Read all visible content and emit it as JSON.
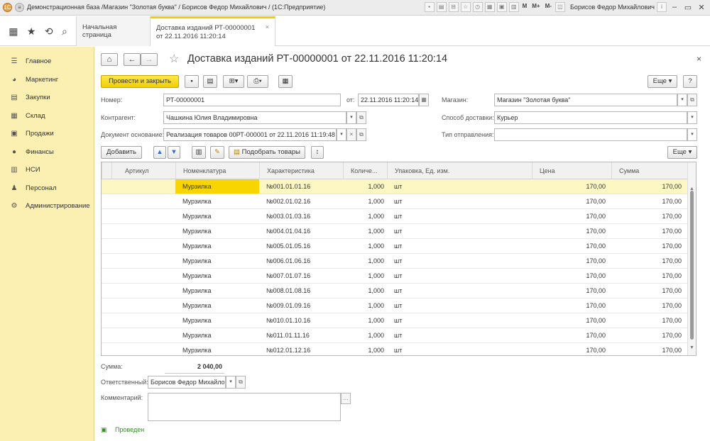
{
  "window": {
    "title": "Демонстрационная база /Магазин \"Золотая буква\" / Борисов Федор Михайлович / (1С:Предприятие)",
    "user": "Борисов Федор Михайлович",
    "m_labels": [
      "M",
      "M+",
      "M-"
    ]
  },
  "tabs": [
    {
      "label": "Начальная страница"
    },
    {
      "label": "Доставка изданий РТ-00000001 от 22.11.2016 11:20:14"
    }
  ],
  "sidebar": {
    "items": [
      {
        "label": "Главное",
        "icon": "menu-lines-icon"
      },
      {
        "label": "Маркетинг",
        "icon": "pie-icon"
      },
      {
        "label": "Закупки",
        "icon": "cart-icon"
      },
      {
        "label": "Склад",
        "icon": "grid-icon"
      },
      {
        "label": "Продажи",
        "icon": "bag-icon"
      },
      {
        "label": "Финансы",
        "icon": "coin-icon"
      },
      {
        "label": "НСИ",
        "icon": "book-icon"
      },
      {
        "label": "Персонал",
        "icon": "person-icon"
      },
      {
        "label": "Администрирование",
        "icon": "gear-icon"
      }
    ]
  },
  "document": {
    "title": "Доставка изданий РТ-00000001 от 22.11.2016 11:20:14",
    "post_and_close": "Провести и закрыть",
    "more": "Еще",
    "fields": {
      "number_label": "Номер:",
      "number": "РТ-00000001",
      "date_label": "от:",
      "date": "22.11.2016 11:20:14",
      "shop_label": "Магазин:",
      "shop": "Магазин \"Золотая буква\"",
      "counterparty_label": "Контрагент:",
      "counterparty": "Чашкина Юлия Владимировна",
      "delivery_label": "Способ доставки:",
      "delivery": "Курьер",
      "base_label": "Документ основание:",
      "base": "Реализация товаров 00РТ-000001 от 22.11.2016 11:19:48",
      "shipping_label": "Тип отправления:",
      "shipping": ""
    },
    "table_toolbar": {
      "add": "Добавить",
      "pick": "Подобрать товары",
      "more": "Еще"
    },
    "table": {
      "columns": [
        "Артикул",
        "Номенклатура",
        "Характеристика",
        "Количе...",
        "Упаковка, Ед. изм.",
        "Цена",
        "Сумма"
      ],
      "rows": [
        [
          "",
          "Мурзилка",
          "№001.01.01.16",
          "1,000",
          "шт",
          "170,00",
          "170,00"
        ],
        [
          "",
          "Мурзилка",
          "№002.01.02.16",
          "1,000",
          "шт",
          "170,00",
          "170,00"
        ],
        [
          "",
          "Мурзилка",
          "№003.01.03.16",
          "1,000",
          "шт",
          "170,00",
          "170,00"
        ],
        [
          "",
          "Мурзилка",
          "№004.01.04.16",
          "1,000",
          "шт",
          "170,00",
          "170,00"
        ],
        [
          "",
          "Мурзилка",
          "№005.01.05.16",
          "1,000",
          "шт",
          "170,00",
          "170,00"
        ],
        [
          "",
          "Мурзилка",
          "№006.01.06.16",
          "1,000",
          "шт",
          "170,00",
          "170,00"
        ],
        [
          "",
          "Мурзилка",
          "№007.01.07.16",
          "1,000",
          "шт",
          "170,00",
          "170,00"
        ],
        [
          "",
          "Мурзилка",
          "№008.01.08.16",
          "1,000",
          "шт",
          "170,00",
          "170,00"
        ],
        [
          "",
          "Мурзилка",
          "№009.01.09.16",
          "1,000",
          "шт",
          "170,00",
          "170,00"
        ],
        [
          "",
          "Мурзилка",
          "№010.01.10.16",
          "1,000",
          "шт",
          "170,00",
          "170,00"
        ],
        [
          "",
          "Мурзилка",
          "№011.01.11.16",
          "1,000",
          "шт",
          "170,00",
          "170,00"
        ],
        [
          "",
          "Мурзилка",
          "№012.01.12.16",
          "1,000",
          "шт",
          "170,00",
          "170,00"
        ]
      ]
    },
    "footer": {
      "sum_label": "Сумма:",
      "sum": "2 040,00",
      "responsible_label": "Ответственный:",
      "responsible": "Борисов Федор Михайло",
      "comment_label": "Комментарий:",
      "comment": "",
      "status": "Проведен"
    }
  }
}
